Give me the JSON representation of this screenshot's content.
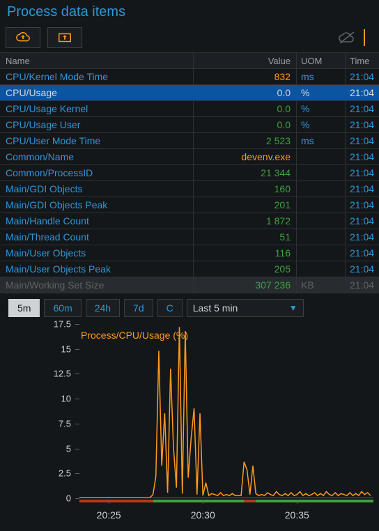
{
  "title": "Process data items",
  "columns": {
    "name": "Name",
    "value": "Value",
    "uom": "UOM",
    "time": "Time"
  },
  "rows": [
    {
      "name": "CPU/Kernel Mode Time",
      "value": "832",
      "uom": "ms",
      "time": "21:04",
      "valcolor": "orange"
    },
    {
      "name": "CPU/Usage",
      "value": "0.0",
      "uom": "%",
      "time": "21:04",
      "selected": true
    },
    {
      "name": "CPU/Usage Kernel",
      "value": "0.0",
      "uom": "%",
      "time": "21:04"
    },
    {
      "name": "CPU/Usage User",
      "value": "0.0",
      "uom": "%",
      "time": "21:04"
    },
    {
      "name": "CPU/User Mode Time",
      "value": "2 523",
      "uom": "ms",
      "time": "21:04"
    },
    {
      "name": "Common/Name",
      "value": "devenv.exe",
      "uom": "",
      "time": "21:04",
      "valcolor": "orange"
    },
    {
      "name": "Common/ProcessID",
      "value": "21 344",
      "uom": "",
      "time": "21:04"
    },
    {
      "name": "Main/GDI Objects",
      "value": "160",
      "uom": "",
      "time": "21:04"
    },
    {
      "name": "Main/GDI Objects Peak",
      "value": "201",
      "uom": "",
      "time": "21:04"
    },
    {
      "name": "Main/Handle Count",
      "value": "1 872",
      "uom": "",
      "time": "21:04"
    },
    {
      "name": "Main/Thread Count",
      "value": "51",
      "uom": "",
      "time": "21:04"
    },
    {
      "name": "Main/User Objects",
      "value": "116",
      "uom": "",
      "time": "21:04"
    },
    {
      "name": "Main/User Objects Peak",
      "value": "205",
      "uom": "",
      "time": "21:04"
    },
    {
      "name": "Main/Working Set Size",
      "value": "307 236",
      "uom": "KB",
      "time": "21:04",
      "dim": true
    }
  ],
  "ranges": {
    "buttons": [
      "5m",
      "60m",
      "24h",
      "7d",
      "C"
    ],
    "active": 0,
    "select": "Last 5 min"
  },
  "chart_data": {
    "type": "line",
    "title": "Process/CPU/Usage (%)",
    "ylabel": "",
    "ylim": [
      0,
      17.5
    ],
    "yticks": [
      0,
      2.5,
      5,
      7.5,
      10,
      12.5,
      15,
      17.5
    ],
    "x_range": [
      "20:23",
      "20:39"
    ],
    "xticks": [
      "20:25",
      "20:30",
      "20:35"
    ],
    "series": [
      {
        "name": "CPU Usage",
        "color": "#ff9a1f",
        "x": [
          0,
          1,
          2,
          3,
          4,
          5,
          6,
          7,
          8,
          9,
          10,
          11,
          12,
          13,
          14,
          15,
          16,
          17,
          18,
          19,
          20,
          21,
          22,
          23,
          24,
          25,
          26,
          27,
          28,
          29,
          30,
          31,
          32,
          33,
          34,
          35,
          36,
          37,
          38,
          39,
          40,
          41,
          42,
          43,
          44,
          45,
          46,
          47,
          48,
          49,
          50,
          51,
          52,
          53,
          54,
          55,
          56,
          57,
          58,
          59,
          60,
          61,
          62,
          63,
          64,
          65,
          66,
          67,
          68,
          69,
          70,
          71,
          72,
          73,
          74,
          75,
          76,
          77,
          78,
          79,
          80,
          81,
          82,
          83,
          84,
          85,
          86,
          87,
          88,
          89,
          90,
          91,
          92,
          93,
          94,
          95,
          96,
          97,
          98,
          99
        ],
        "values": [
          0,
          0,
          0,
          0,
          0,
          0,
          0,
          0,
          0,
          0,
          0,
          0,
          0,
          0,
          0,
          0,
          0,
          0,
          0,
          0,
          0,
          0,
          0,
          0,
          0,
          0.3,
          2.1,
          14.8,
          3.2,
          8.5,
          0.5,
          13.0,
          5.0,
          1.0,
          17.2,
          0.4,
          16.8,
          2.0,
          6.0,
          9.0,
          0.3,
          8.5,
          0.2,
          1.5,
          0.2,
          0.4,
          0.3,
          0.2,
          0.5,
          0.2,
          0.3,
          0.2,
          0.4,
          0.2,
          0.2,
          0.2,
          3.6,
          2.8,
          0.3,
          3.2,
          0.4,
          0.2,
          0.3,
          0.2,
          0.5,
          0.3,
          0.2,
          0.6,
          0.3,
          0.2,
          0.4,
          0.2,
          0.5,
          0.2,
          0.3,
          0.6,
          0.2,
          0.4,
          0.2,
          0.3,
          0.5,
          0.2,
          0.4,
          0.2,
          0.6,
          0.3,
          0.2,
          0.5,
          0.2,
          0.4,
          0.3,
          0.2,
          0.5,
          0.2,
          0.4,
          0.2,
          0.6,
          0.3,
          0.5,
          0.2
        ]
      }
    ],
    "status_segments": [
      {
        "from": 0,
        "to": 25,
        "state": "red"
      },
      {
        "from": 25,
        "to": 56,
        "state": "green"
      },
      {
        "from": 56,
        "to": 60,
        "state": "red"
      },
      {
        "from": 60,
        "to": 100,
        "state": "green"
      }
    ]
  }
}
